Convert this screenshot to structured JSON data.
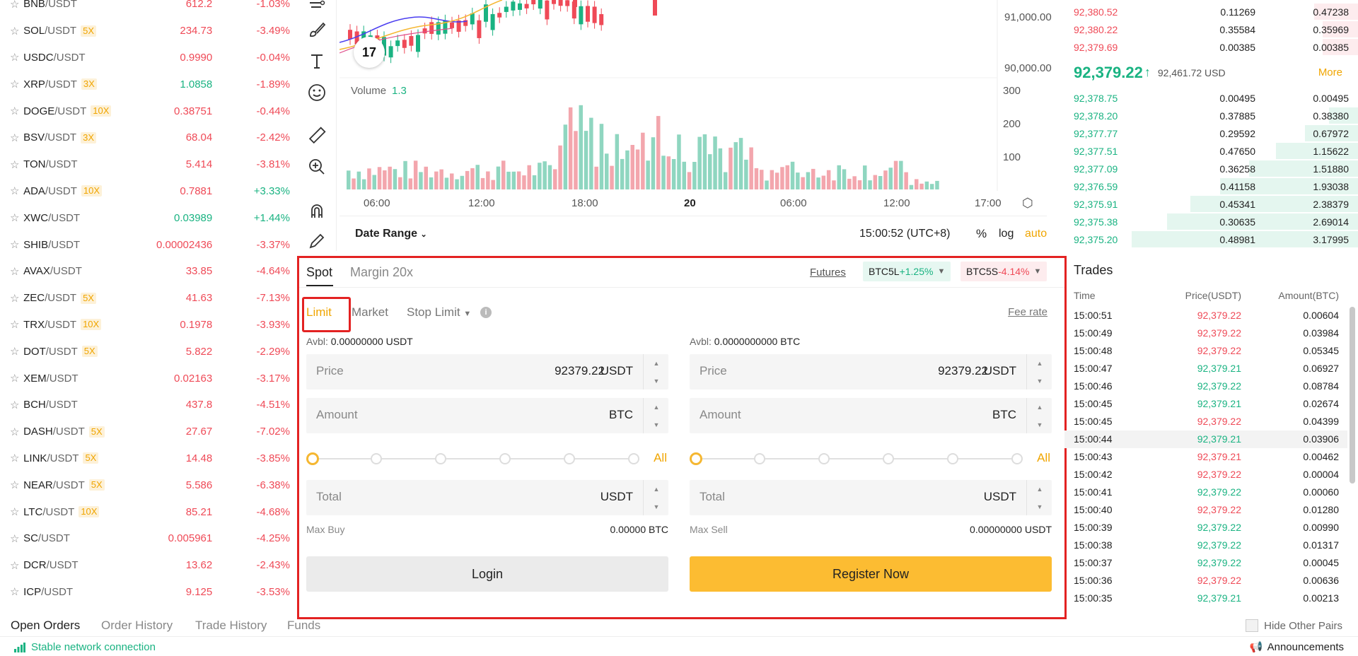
{
  "markets": [
    {
      "base": "BNB",
      "quote": "/USDT",
      "lev": "",
      "price": "612.2",
      "change": "-1.03%",
      "dir": "down"
    },
    {
      "base": "SOL",
      "quote": "/USDT",
      "lev": "5X",
      "price": "234.73",
      "change": "-3.49%",
      "dir": "down"
    },
    {
      "base": "USDC",
      "quote": "/USDT",
      "lev": "",
      "price": "0.9990",
      "change": "-0.04%",
      "dir": "down"
    },
    {
      "base": "XRP",
      "quote": "/USDT",
      "lev": "3X",
      "price": "1.0858",
      "change": "-1.89%",
      "dir": "down",
      "price_dir": "up"
    },
    {
      "base": "DOGE",
      "quote": "/USDT",
      "lev": "10X",
      "price": "0.38751",
      "change": "-0.44%",
      "dir": "down"
    },
    {
      "base": "BSV",
      "quote": "/USDT",
      "lev": "3X",
      "price": "68.04",
      "change": "-2.42%",
      "dir": "down"
    },
    {
      "base": "TON",
      "quote": "/USDT",
      "lev": "",
      "price": "5.414",
      "change": "-3.81%",
      "dir": "down"
    },
    {
      "base": "ADA",
      "quote": "/USDT",
      "lev": "10X",
      "price": "0.7881",
      "change": "+3.33%",
      "dir": "up",
      "price_dir": "down"
    },
    {
      "base": "XWC",
      "quote": "/USDT",
      "lev": "",
      "price": "0.03989",
      "change": "+1.44%",
      "dir": "up"
    },
    {
      "base": "SHIB",
      "quote": "/USDT",
      "lev": "",
      "price": "0.00002436",
      "change": "-3.37%",
      "dir": "down"
    },
    {
      "base": "AVAX",
      "quote": "/USDT",
      "lev": "",
      "price": "33.85",
      "change": "-4.64%",
      "dir": "down"
    },
    {
      "base": "ZEC",
      "quote": "/USDT",
      "lev": "5X",
      "price": "41.63",
      "change": "-7.13%",
      "dir": "down"
    },
    {
      "base": "TRX",
      "quote": "/USDT",
      "lev": "10X",
      "price": "0.1978",
      "change": "-3.93%",
      "dir": "down"
    },
    {
      "base": "DOT",
      "quote": "/USDT",
      "lev": "5X",
      "price": "5.822",
      "change": "-2.29%",
      "dir": "down"
    },
    {
      "base": "XEM",
      "quote": "/USDT",
      "lev": "",
      "price": "0.02163",
      "change": "-3.17%",
      "dir": "down"
    },
    {
      "base": "BCH",
      "quote": "/USDT",
      "lev": "",
      "price": "437.8",
      "change": "-4.51%",
      "dir": "down"
    },
    {
      "base": "DASH",
      "quote": "/USDT",
      "lev": "5X",
      "price": "27.67",
      "change": "-7.02%",
      "dir": "down"
    },
    {
      "base": "LINK",
      "quote": "/USDT",
      "lev": "5X",
      "price": "14.48",
      "change": "-3.85%",
      "dir": "down"
    },
    {
      "base": "NEAR",
      "quote": "/USDT",
      "lev": "5X",
      "price": "5.586",
      "change": "-6.38%",
      "dir": "down"
    },
    {
      "base": "LTC",
      "quote": "/USDT",
      "lev": "10X",
      "price": "85.21",
      "change": "-4.68%",
      "dir": "down"
    },
    {
      "base": "SC",
      "quote": "/USDT",
      "lev": "",
      "price": "0.005961",
      "change": "-4.25%",
      "dir": "down"
    },
    {
      "base": "DCR",
      "quote": "/USDT",
      "lev": "",
      "price": "13.62",
      "change": "-2.43%",
      "dir": "down"
    },
    {
      "base": "ICP",
      "quote": "/USDT",
      "lev": "",
      "price": "9.125",
      "change": "-3.53%",
      "dir": "down"
    }
  ],
  "chart": {
    "price_ticks": [
      "91,000.00",
      "90,000.00"
    ],
    "volume_ticks": [
      "300",
      "200",
      "100"
    ],
    "time_ticks": [
      "06:00",
      "12:00",
      "18:00",
      "20",
      "06:00",
      "12:00",
      "17:00"
    ],
    "volume_label": "Volume",
    "volume_value": "1.3",
    "tv_logo": "17",
    "date_range": "Date Range",
    "clock": "15:00:52 (UTC+8)",
    "pct": "%",
    "log": "log",
    "auto": "auto",
    "colors": {
      "up": "#1ab382",
      "down": "#ef4a57",
      "up_vol": "#8fd6c0",
      "down_vol": "#f3a6ad"
    }
  },
  "orderbook": {
    "asks": [
      {
        "price": "92,380.52",
        "amount": "0.11269",
        "total": "0.47238",
        "depth": 0.15
      },
      {
        "price": "92,380.22",
        "amount": "0.35584",
        "total": "0.35969",
        "depth": 0.12
      },
      {
        "price": "92,379.69",
        "amount": "0.00385",
        "total": "0.00385",
        "depth": 0.12
      }
    ],
    "last_price": "92,379.22",
    "last_usd": "92,461.72 USD",
    "more": "More",
    "bids": [
      {
        "price": "92,378.75",
        "amount": "0.00495",
        "total": "0.00495",
        "depth": 0.0
      },
      {
        "price": "92,378.20",
        "amount": "0.37885",
        "total": "0.38380",
        "depth": 0.1
      },
      {
        "price": "92,377.77",
        "amount": "0.29592",
        "total": "0.67972",
        "depth": 0.18
      },
      {
        "price": "92,377.51",
        "amount": "0.47650",
        "total": "1.15622",
        "depth": 0.28
      },
      {
        "price": "92,377.09",
        "amount": "0.36258",
        "total": "1.51880",
        "depth": 0.37
      },
      {
        "price": "92,376.59",
        "amount": "0.41158",
        "total": "1.93038",
        "depth": 0.47
      },
      {
        "price": "92,375.91",
        "amount": "0.45341",
        "total": "2.38379",
        "depth": 0.57
      },
      {
        "price": "92,375.38",
        "amount": "0.30635",
        "total": "2.69014",
        "depth": 0.65
      },
      {
        "price": "92,375.20",
        "amount": "0.48981",
        "total": "3.17995",
        "depth": 0.77
      }
    ]
  },
  "trade_panel": {
    "tab_spot": "Spot",
    "tab_margin": "Margin 20x",
    "futures": "Futures",
    "btc5l_name": "BTC5L",
    "btc5l_chg": "+1.25%",
    "btc5s_name": "BTC5S",
    "btc5s_chg": "-4.14%",
    "order_limit": "Limit",
    "order_market": "Market",
    "order_stop": "Stop Limit",
    "fee_rate": "Fee rate",
    "buy": {
      "avbl_label": "Avbl:",
      "avbl_value": "0.00000000 USDT",
      "price_label": "Price",
      "price_value": "92379.22",
      "price_unit": "USDT",
      "amount_label": "Amount",
      "amount_unit": "BTC",
      "all": "All",
      "total_label": "Total",
      "total_unit": "USDT",
      "max_label": "Max Buy",
      "max_value": "0.00000 BTC",
      "button": "Login"
    },
    "sell": {
      "avbl_label": "Avbl:",
      "avbl_value": "0.0000000000 BTC",
      "price_label": "Price",
      "price_value": "92379.22",
      "price_unit": "USDT",
      "amount_label": "Amount",
      "amount_unit": "BTC",
      "all": "All",
      "total_label": "Total",
      "total_unit": "USDT",
      "max_label": "Max Sell",
      "max_value": "0.00000000 USDT",
      "button": "Register Now"
    }
  },
  "trades": {
    "title": "Trades",
    "head_time": "Time",
    "head_price": "Price(USDT)",
    "head_amount": "Amount(BTC)",
    "rows": [
      {
        "time": "15:00:51",
        "price": "92,379.22",
        "amount": "0.00604",
        "dir": "down"
      },
      {
        "time": "15:00:49",
        "price": "92,379.22",
        "amount": "0.03984",
        "dir": "down"
      },
      {
        "time": "15:00:48",
        "price": "92,379.22",
        "amount": "0.05345",
        "dir": "down"
      },
      {
        "time": "15:00:47",
        "price": "92,379.21",
        "amount": "0.06927",
        "dir": "up"
      },
      {
        "time": "15:00:46",
        "price": "92,379.22",
        "amount": "0.08784",
        "dir": "up"
      },
      {
        "time": "15:00:45",
        "price": "92,379.21",
        "amount": "0.02674",
        "dir": "up"
      },
      {
        "time": "15:00:45",
        "price": "92,379.22",
        "amount": "0.04399",
        "dir": "down"
      },
      {
        "time": "15:00:44",
        "price": "92,379.21",
        "amount": "0.03906",
        "dir": "up",
        "hl": true
      },
      {
        "time": "15:00:43",
        "price": "92,379.21",
        "amount": "0.00462",
        "dir": "down"
      },
      {
        "time": "15:00:42",
        "price": "92,379.22",
        "amount": "0.00004",
        "dir": "down"
      },
      {
        "time": "15:00:41",
        "price": "92,379.22",
        "amount": "0.00060",
        "dir": "up"
      },
      {
        "time": "15:00:40",
        "price": "92,379.22",
        "amount": "0.01280",
        "dir": "down"
      },
      {
        "time": "15:00:39",
        "price": "92,379.22",
        "amount": "0.00990",
        "dir": "up"
      },
      {
        "time": "15:00:38",
        "price": "92,379.22",
        "amount": "0.01317",
        "dir": "up"
      },
      {
        "time": "15:00:37",
        "price": "92,379.22",
        "amount": "0.00045",
        "dir": "up"
      },
      {
        "time": "15:00:36",
        "price": "92,379.22",
        "amount": "0.00636",
        "dir": "down"
      },
      {
        "time": "15:00:35",
        "price": "92,379.21",
        "amount": "0.00213",
        "dir": "up"
      }
    ]
  },
  "bottom": {
    "open_orders": "Open Orders",
    "order_history": "Order History",
    "trade_history": "Trade History",
    "funds": "Funds",
    "hide_pairs": "Hide Other Pairs",
    "network": "Stable network connection",
    "announcements": "Announcements"
  }
}
